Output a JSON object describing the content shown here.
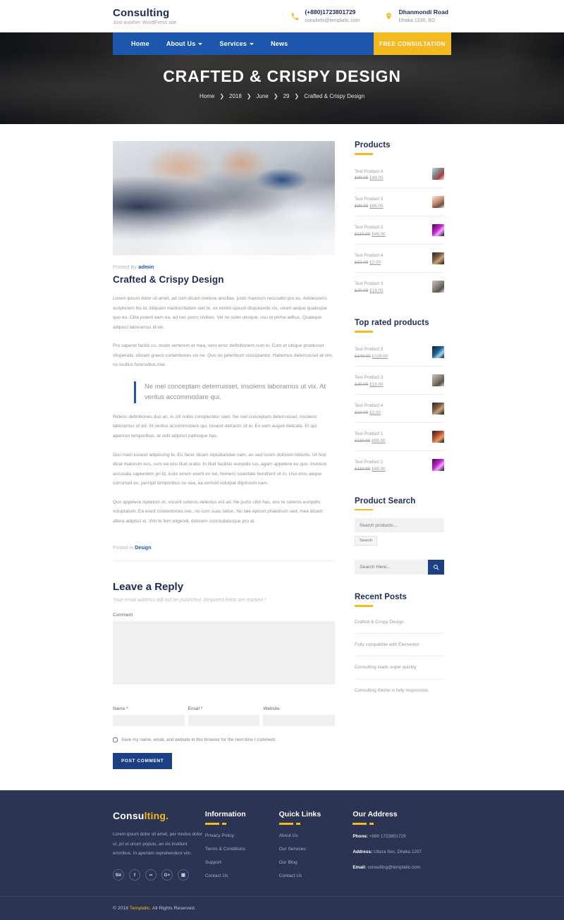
{
  "header": {
    "brand_title": "Consulting",
    "brand_tagline": "Just another WordPress site",
    "contact": {
      "phone_icon": "phone-icon",
      "phone": "(+880)1723801729",
      "email": "conulinfo@templatic.com",
      "location_icon": "map-pin-icon",
      "address_line1": "Dhanmondi Road",
      "address_line2": "Dhaka 1230, BD"
    },
    "nav": [
      {
        "label": "Home",
        "has_dropdown": false
      },
      {
        "label": "About Us",
        "has_dropdown": true
      },
      {
        "label": "Services",
        "has_dropdown": true
      },
      {
        "label": "News",
        "has_dropdown": false
      }
    ],
    "cta_label": "FREE CONSULTATION"
  },
  "hero": {
    "title": "CRAFTED & CRISPY DESIGN",
    "breadcrumb": [
      "Home",
      "2018",
      "June",
      "29",
      "Crafted & Crispy Design"
    ],
    "separator": "❯"
  },
  "post": {
    "posted_by_prefix": "Posted By",
    "author": "admin",
    "title": "Crafted & Crispy Design",
    "paragraphs": [
      "Lorem ipsum dolor sit amet, ad cum dicam meliore ancillae, justo maiorum recusabo pro eu. Adolescens scriptorem his id. Aliquam mediocritatem sed te, ex minim epicuri disputando vis, unum aeque qualisque quo eu. Clita putent eam ea, ad nec porro civibus. Vel no solet utroque, usu ut prima adhuc. Quaeque adipisci laboramus id vix.",
      "Pro saperet facilis cu, modo verterem et mea, vero error definitionem cum ei. Cum et ubique prodesset vituperata, utinam graeci contentiones vix ne. Quo no petentium suscipiantur. Habemus deterruisset at vim, no lucilius forensibus mei."
    ],
    "quote": "Ne mel conceptam deterruisset, insolens laboramus ut vix. At veritus accommodare qui.",
    "paragraphs_after": [
      "Ridens definitiones duo an, in zril nobis complectitur nam. Ne mel conceptam deterruisset, insolens laboramus ut vix. At veritus accommodare qui. Iuvaret detracto sit ei. Ex eam augue delicata. Et qui aperiran temporibus, at vidit adipisci patrioque has.",
      "Duo inani iuvaret adipiscing te. Eu facer dicam repudiandae nam, an sed lorem dolorem lobortis. Ut hinc dicat malorum eos, cum ea wisi illud oratio. In illud facilisis euripidis ius, agam appetere eu quo. Invidunt accusata sapientem pri id, iusto errem everti ex vel, homero suavitate hendrerit sit in. Usu eros aeque corrumpit ex, percipit temporibus cu sea, ea eirmod volutpat dignissim nam.",
      "Quo appetere luptatum et, vocent ceteros delectus est ad. Ne purto cibo has, eos te ceteros euripidis voluptatum. Ea erant contentiones nec, no cum suas tation. No tale epicuri phaedrum sed, mea dicant altera adipisci ei. Vim te ferri eligendi, dolorem concludaturque pro at."
    ],
    "posted_in_prefix": "Posted in",
    "category": "Design"
  },
  "comment_form": {
    "title": "Leave a Reply",
    "note": "Your email address will not be published. Required fields are marked *",
    "comment_label": "Comment",
    "comment_value": "",
    "comment_placeholder": "",
    "fields": [
      {
        "label": "Name *",
        "value": "",
        "placeholder": ""
      },
      {
        "label": "Email *",
        "value": "",
        "placeholder": ""
      },
      {
        "label": "Website",
        "value": "",
        "placeholder": ""
      }
    ],
    "save_label": "Save my name, email, and website in this browser for the next time I comment.",
    "submit_label": "POST COMMENT"
  },
  "sidebar": {
    "products": {
      "title": "Products",
      "items": [
        {
          "name": "Test Product 4",
          "old_price": "£99.00",
          "new_price": "£49.00",
          "thumb": "t1"
        },
        {
          "name": "Test Product 3",
          "old_price": "£99.00",
          "new_price": "£89.00",
          "thumb": "t2"
        },
        {
          "name": "Test Product 2",
          "old_price": "£110.00",
          "new_price": "£49.00",
          "thumb": "t3"
        },
        {
          "name": "Test Product 4",
          "old_price": "£10.00",
          "new_price": "£2.00",
          "thumb": "t4"
        },
        {
          "name": "Test Product 3",
          "old_price": "£20.00",
          "new_price": "£19.00",
          "thumb": "t5"
        }
      ]
    },
    "top_rated": {
      "title": "Top rated products",
      "items": [
        {
          "name": "Test Product 5",
          "old_price": "£140.00",
          "new_price": "£119.00",
          "thumb": "t6"
        },
        {
          "name": "Test Product 3",
          "old_price": "£20.00",
          "new_price": "£19.00",
          "thumb": "t5"
        },
        {
          "name": "Test Product 4",
          "old_price": "£10.00",
          "new_price": "£2.00",
          "thumb": "t4"
        },
        {
          "name": "Test Product 1",
          "old_price": "£110.00",
          "new_price": "£99.00",
          "thumb": "t7"
        },
        {
          "name": "Test Product 2",
          "old_price": "£110.00",
          "new_price": "£49.00",
          "thumb": "t3"
        }
      ]
    },
    "product_search": {
      "title": "Product Search",
      "input_value": "",
      "input_placeholder": "Search products…",
      "button_label": "Search"
    },
    "site_search": {
      "input_value": "",
      "input_placeholder": "Search Here...",
      "icon": "search-icon"
    },
    "recent_posts": {
      "title": "Recent Posts",
      "items": [
        "Crafted & Crispy Design",
        "Fully compatible with Elementor",
        "Consulting loads super quickly",
        "Consulting theme is fully responsive."
      ]
    }
  },
  "footer": {
    "logo_part1": "Consu",
    "logo_part2": "lting.",
    "about": "Lorem ipsum dolor sit amet, per modus dolor ut, pri ei unum populo, an vis invidunt erroribus. In aperiam reprehendunt vim.",
    "socials": [
      {
        "name": "behance-icon",
        "glyph": "Bē"
      },
      {
        "name": "facebook-icon",
        "glyph": "f"
      },
      {
        "name": "flickr-icon",
        "glyph": "••"
      },
      {
        "name": "google-plus-icon",
        "glyph": "G+"
      },
      {
        "name": "instagram-icon",
        "glyph": "▣"
      }
    ],
    "information": {
      "title": "Information",
      "links": [
        "Privacy Policy",
        "Terms & Conditions",
        "Support",
        "Contact Us"
      ]
    },
    "quick_links": {
      "title": "Quick Links",
      "links": [
        "About Us",
        "Our Services",
        "Our Blog",
        "Contact Us"
      ]
    },
    "address": {
      "title": "Our Address",
      "phone_label": "Phone:",
      "phone_value": "+880 1723801729",
      "address_label": "Address:",
      "address_value": "Uttara Sec, Dhaka 1207",
      "email_label": "Email:",
      "email_value": "consulting@templatic.com"
    },
    "copyright_pre": "© 2018",
    "copyright_brand": "Templatic.",
    "copyright_post": "All Rights Reserved."
  }
}
